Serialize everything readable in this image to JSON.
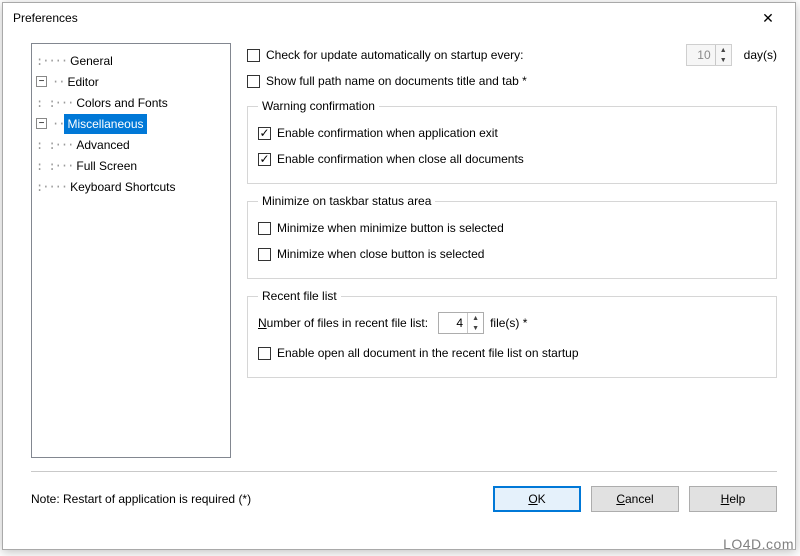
{
  "window": {
    "title": "Preferences"
  },
  "tree": {
    "items": [
      {
        "label": "General",
        "depth": 1,
        "toggle": null,
        "selected": false
      },
      {
        "label": "Editor",
        "depth": 0,
        "toggle": "-",
        "selected": false
      },
      {
        "label": "Colors and Fonts",
        "depth": 2,
        "toggle": null,
        "selected": false
      },
      {
        "label": "Miscellaneous",
        "depth": 0,
        "toggle": "-",
        "selected": true
      },
      {
        "label": "Advanced",
        "depth": 2,
        "toggle": null,
        "selected": false
      },
      {
        "label": "Full Screen",
        "depth": 2,
        "toggle": null,
        "selected": false
      },
      {
        "label": "Keyboard Shortcuts",
        "depth": 1,
        "toggle": null,
        "selected": false
      }
    ]
  },
  "pane": {
    "check_update": {
      "label": "Check for update automatically on startup every:",
      "checked": false,
      "value": "10",
      "unit": "day(s)",
      "enabled": false
    },
    "full_path": {
      "label": "Show full path name on documents title and tab *",
      "checked": false
    },
    "warning_group": {
      "legend": "Warning confirmation",
      "exit": {
        "label": "Enable confirmation when application exit",
        "checked": true
      },
      "close_all": {
        "label": "Enable confirmation when close all documents",
        "checked": true
      }
    },
    "minimize_group": {
      "legend": "Minimize on taskbar status area",
      "min_button": {
        "label": "Minimize when minimize button is selected",
        "checked": false
      },
      "close_button": {
        "label": "Minimize when close button is selected",
        "checked": false
      }
    },
    "recent_group": {
      "legend": "Recent file list",
      "num_label_pre": "N",
      "num_label_post": "umber of files in recent file list:",
      "value": "4",
      "unit": "file(s) *",
      "open_all": {
        "label": "Enable open all document in the recent file list on startup",
        "checked": false
      }
    }
  },
  "footer": {
    "note": "Note: Restart of application is required (*)",
    "ok_pre": "O",
    "ok_post": "K",
    "cancel_pre": "C",
    "cancel_post": "ancel",
    "help_pre": "H",
    "help_post": "elp"
  },
  "watermark": "LO4D.com"
}
